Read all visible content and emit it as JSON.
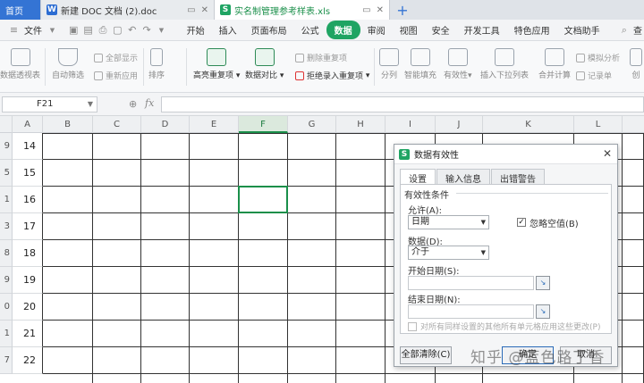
{
  "tabs": {
    "home": "首页",
    "doc": "新建 DOC 文档 (2).doc",
    "xls": "实名制管理参考样表.xls",
    "doc_badge": "W",
    "xls_badge": "S",
    "add": "+"
  },
  "menubar": {
    "file": "文件",
    "items": [
      "开始",
      "插入",
      "页面布局",
      "公式",
      "数据",
      "审阅",
      "视图",
      "安全",
      "开发工具",
      "特色应用",
      "文档助手"
    ],
    "active_index": 4,
    "search_label": "查"
  },
  "ribbon": {
    "pivot": "数据透视表",
    "auto_filter": "自动筛选",
    "show_all": "全部显示",
    "reapply": "重新应用",
    "sort": "排序",
    "highlight_dup": "高亮重复项",
    "data_compare": "数据对比",
    "delete_dup": "删除重复项",
    "reject_dup": "拒绝录入重复项",
    "split": "分列",
    "smart_fill": "智能填充",
    "validity": "有效性",
    "dropdown": "插入下拉列表",
    "consolidate": "合并计算",
    "simulate": "模拟分析",
    "record": "记录单",
    "create": "创"
  },
  "formula_bar": {
    "cell_ref": "F21",
    "fx": "fx"
  },
  "grid": {
    "columns": [
      "A",
      "B",
      "C",
      "D",
      "E",
      "F",
      "G",
      "H",
      "I",
      "J",
      "K",
      "L"
    ],
    "selected_column": "F",
    "row_numbers": [
      "9",
      "5",
      "1",
      "3",
      "8",
      "9",
      "0",
      "1",
      "7"
    ],
    "values": [
      "14",
      "15",
      "16",
      "17",
      "18",
      "19",
      "20",
      "21",
      "22"
    ]
  },
  "dialog": {
    "title": "数据有效性",
    "app_badge": "S",
    "close": "✕",
    "tabs": [
      "设置",
      "输入信息",
      "出错警告"
    ],
    "active_tab": 0,
    "group_title": "有效性条件",
    "allow_label": "允许(A):",
    "allow_value": "日期",
    "ignore_blank": "忽略空值(B)",
    "data_label": "数据(D):",
    "data_value": "介于",
    "start_label": "开始日期(S):",
    "end_label": "结束日期(N):",
    "apply_all": "对所有同样设置的其他所有单元格应用这些更改(P)",
    "clear_all": "全部清除(C)",
    "ok": "确定",
    "cancel": "取消"
  },
  "watermark": "知乎 @蓝色路丁香",
  "colors": {
    "accent": "#1fa463",
    "selection": "#1a8f4a",
    "home_tab": "#3474d4"
  }
}
